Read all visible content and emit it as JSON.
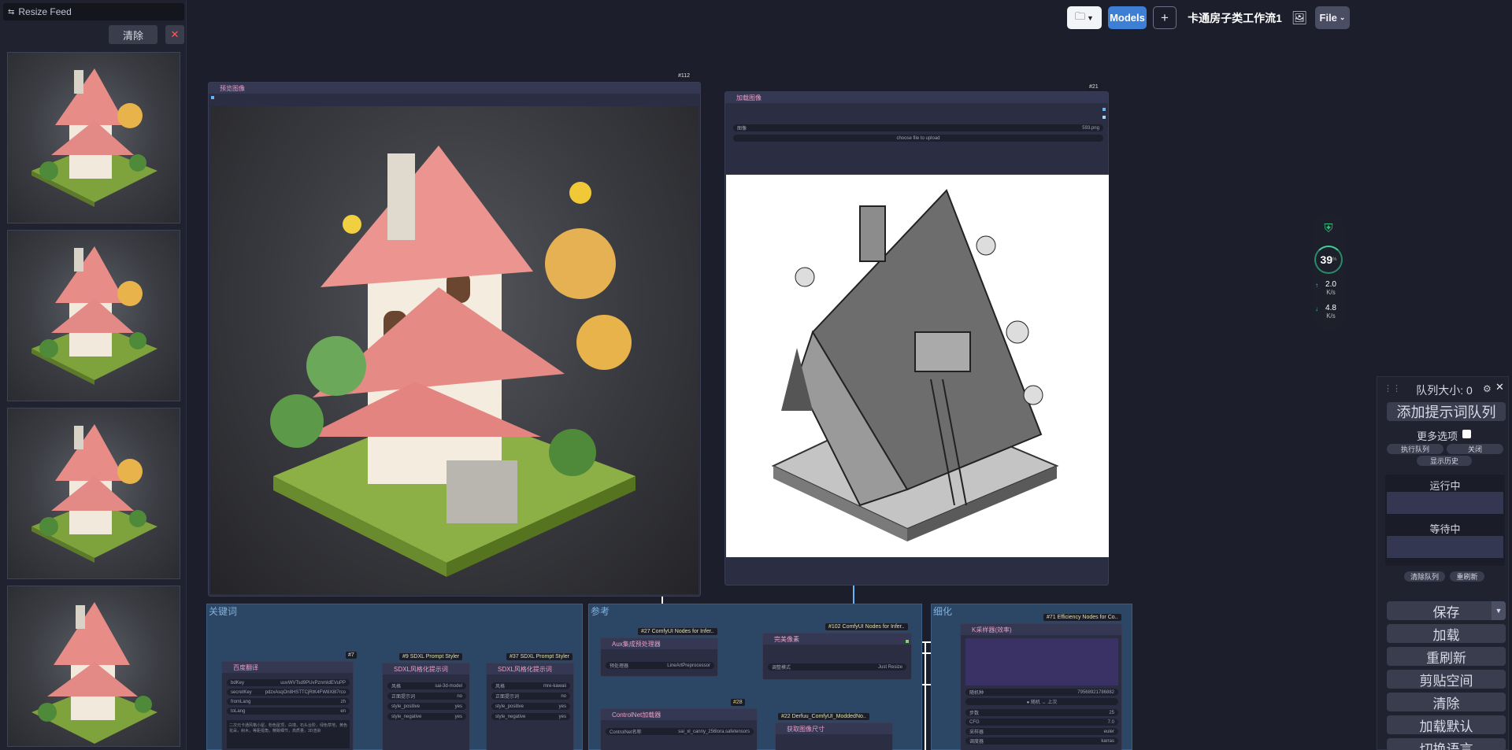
{
  "feed": {
    "title": "Resize Feed",
    "clear_label": "清除",
    "close_label": "✕",
    "thumb_count": 4
  },
  "toolbar": {
    "models_label": "Models",
    "add_label": "+",
    "workflow_title": "卡通房子类工作流1",
    "file_label": "File"
  },
  "monitor": {
    "percent": "39",
    "percent_unit": "%",
    "up_value": "2.0",
    "up_unit": "K/s",
    "down_value": "4.8",
    "down_unit": "K/s"
  },
  "nodes": {
    "preview": {
      "id": "#112",
      "title": "预览图像"
    },
    "load": {
      "id": "#21",
      "title": "加载图像",
      "image_label": "图像",
      "image_value": "593.png",
      "upload_label": "choose file to upload"
    }
  },
  "groups": {
    "keywords": {
      "title": "关键词",
      "n7_id": "#7",
      "translate_title": "百度翻译",
      "widgets": [
        {
          "label": "bdKey",
          "value": "uuvWVTsd9PUvPznmIdEVuPP"
        },
        {
          "label": "secretKey",
          "value": "pdzxAsqOn8HSTTCjRtK4FW8X8I7rco"
        },
        {
          "label": "fromLang",
          "value": "zh"
        },
        {
          "label": "toLang",
          "value": "en"
        }
      ],
      "translate_text": "二次元卡通风格小屋，粉色屋顶，白墙，石头台阶，绿色草地，黄色花朵，树木，等距视角，精致细节，高质量，3D渲染",
      "styler9_badge": "#9 SDXL Prompt Styler",
      "styler9_title": "SDXL风格化提示词",
      "styler9_widgets": [
        {
          "label": "风格",
          "value": "sai-3d-model"
        },
        {
          "label": "正面提示词",
          "value": "no"
        },
        {
          "label": "style_positive",
          "value": "yes"
        },
        {
          "label": "style_negative",
          "value": "yes"
        }
      ],
      "styler37_badge": "#37 SDXL Prompt Styler",
      "styler37_title": "SDXL风格化提示词",
      "styler37_widgets": [
        {
          "label": "风格",
          "value": "mre-kawaii"
        },
        {
          "label": "正面提示词",
          "value": "no"
        },
        {
          "label": "style_positive",
          "value": "yes"
        },
        {
          "label": "style_negative",
          "value": "yes"
        }
      ]
    },
    "preprocess": {
      "title": "参考",
      "aux_badge": "#27 ComfyUI Nodes for Infer..",
      "aux_title": "Aux集成预处理器",
      "aux_widget_label": "预处理器",
      "aux_widget_value": "LineArtPreprocessor",
      "resize_badge": "#102 ComfyUI Nodes for Infer..",
      "resize_title": "完美像素",
      "resize_widget_label": "调整模式",
      "resize_widget_value": "Just Resize",
      "n28_badge": "#28",
      "controlnet_title": "ControlNet加载器",
      "controlnet_widget_label": "ControlNet名称",
      "controlnet_widget_value": "sai_xl_canny_256lora.safetensors",
      "size_badge": "#22 Derfuu_ComfyUI_ModdedNo..",
      "size_title": "获取图像尺寸"
    },
    "sampler": {
      "title": "细化",
      "badge": "#71 Efficiency Nodes for Co..",
      "title_node": "K采样器(效率)",
      "widgets": [
        {
          "label": "随机种",
          "value": "79568921786882"
        },
        {
          "label": "",
          "value": "● 随机 ↔ 上次"
        },
        {
          "label": "步数",
          "value": "25"
        },
        {
          "label": "CFG",
          "value": "7.0"
        },
        {
          "label": "采样器",
          "value": "euler"
        },
        {
          "label": "调度器",
          "value": "karras"
        }
      ]
    }
  },
  "queue": {
    "size_label": "队列大小: 0",
    "add_prompt_label": "添加提示词队列",
    "more_options_label": "更多选项",
    "exec_queue_label": "执行队列",
    "close_label": "关闭",
    "show_history_label": "显示历史",
    "running_label": "运行中",
    "pending_label": "等待中",
    "clear_queue_label": "清除队列",
    "refresh_label": "重刷新",
    "save_label": "保存",
    "load_label": "加载",
    "refresh2_label": "重刷新",
    "clipspace_label": "剪贴空间",
    "clear_label": "清除",
    "load_default_label": "加载默认",
    "switch_lang_label": "切换语言"
  },
  "colors": {
    "accent": "#3d7fd4",
    "background": "#1c1e2c",
    "node": "#2b2e42",
    "group": "#2c4765",
    "link_green": "#7ed957",
    "link_blue": "#64b5f6"
  }
}
